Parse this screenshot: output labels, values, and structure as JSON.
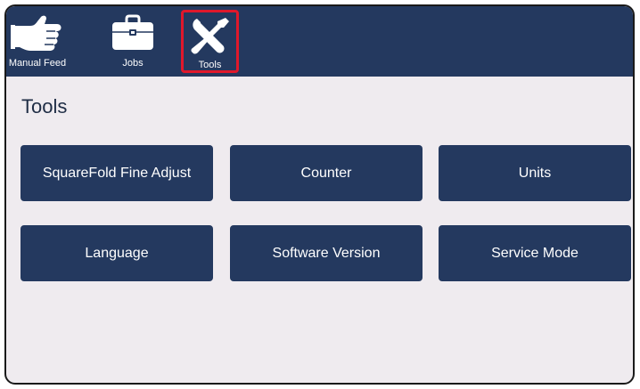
{
  "nav": {
    "items": [
      {
        "label": "Manual Feed",
        "icon": "hand-icon"
      },
      {
        "label": "Jobs",
        "icon": "briefcase-icon"
      },
      {
        "label": "Tools",
        "icon": "wrench-screwdriver-icon",
        "selected": true
      }
    ]
  },
  "page": {
    "title": "Tools"
  },
  "tiles": [
    {
      "label": "SquareFold Fine Adjust"
    },
    {
      "label": "Counter"
    },
    {
      "label": "Units"
    },
    {
      "label": "Language"
    },
    {
      "label": "Software Version"
    },
    {
      "label": "Service Mode"
    }
  ],
  "colors": {
    "navy": "#24395f",
    "background": "#efebef",
    "selection": "#e0182b"
  }
}
